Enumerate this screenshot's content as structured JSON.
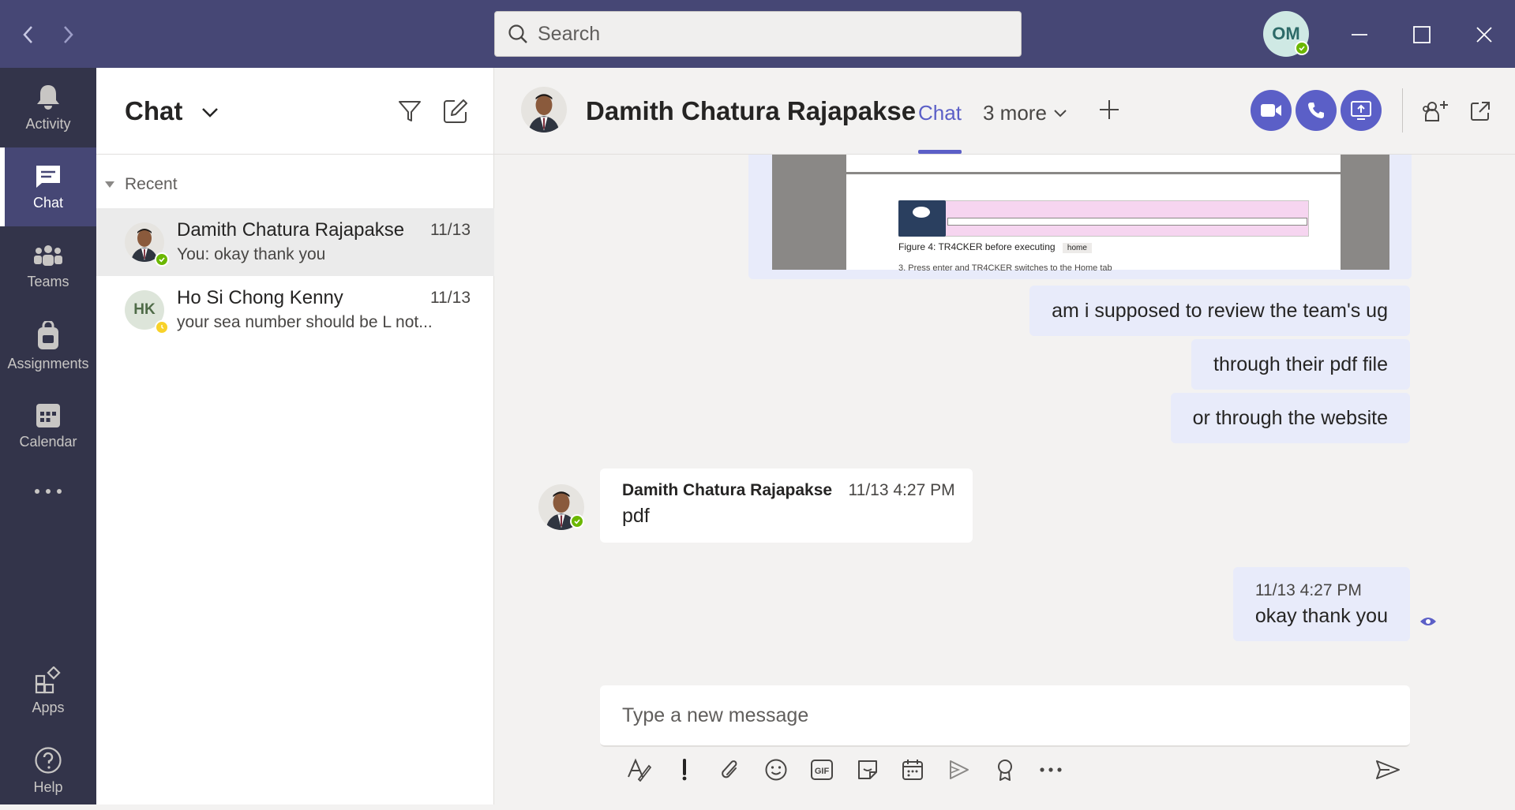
{
  "titlebar": {
    "search_placeholder": "Search",
    "user_initials": "OM"
  },
  "rail": {
    "items": [
      {
        "label": "Activity",
        "icon": "bell-icon"
      },
      {
        "label": "Chat",
        "icon": "chat-icon",
        "active": true
      },
      {
        "label": "Teams",
        "icon": "teams-icon"
      },
      {
        "label": "Assignments",
        "icon": "assignments-icon"
      },
      {
        "label": "Calendar",
        "icon": "calendar-icon"
      },
      {
        "label": "",
        "icon": "more-icon"
      }
    ],
    "bottom": [
      {
        "label": "Apps",
        "icon": "apps-icon"
      },
      {
        "label": "Help",
        "icon": "help-icon"
      }
    ]
  },
  "chat_list": {
    "title": "Chat",
    "section": "Recent",
    "conversations": [
      {
        "name": "Damith Chatura Rajapakse",
        "date": "11/13",
        "preview": "You: okay thank you",
        "status": "available"
      },
      {
        "name": "Ho Si Chong Kenny",
        "initials": "HK",
        "date": "11/13",
        "preview": "your sea number should be L not...",
        "status": "away"
      }
    ]
  },
  "conversation": {
    "name": "Damith Chatura Rajapakse",
    "tabs": {
      "chat": "Chat",
      "more": "3 more"
    },
    "shared_image": {
      "caption": "Figure 4: TR4CKER before executing",
      "tag": "home",
      "footer_text": "3. Press enter and TR4CKER switches to the Home tab"
    },
    "messages_me": [
      {
        "text": "am i supposed to review the team's ug"
      },
      {
        "text": "through their pdf file"
      },
      {
        "text": "or through the website"
      }
    ],
    "message_other": {
      "sender": "Damith Chatura Rajapakse",
      "time": "11/13 4:27 PM",
      "text": "pdf"
    },
    "last_me": {
      "time": "11/13 4:27 PM",
      "text": "okay thank you"
    }
  },
  "compose": {
    "placeholder": "Type a new message"
  },
  "colors": {
    "titlebar": "#464775",
    "rail": "#33344a",
    "accent": "#5b5fc7",
    "my_bubble": "#e8ebfa",
    "available": "#6bb700",
    "away": "#f8d22a"
  }
}
